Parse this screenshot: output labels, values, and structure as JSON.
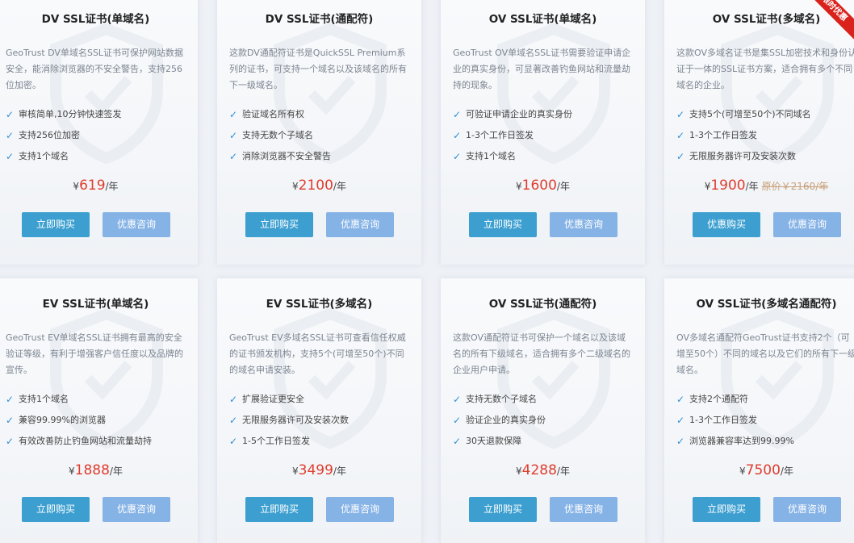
{
  "cards": [
    {
      "title": "DV SSL证书(单域名)",
      "desc": "GeoTrust DV单域名SSL证书可保护网站数据安全，能消除浏览器的不安全警告，支持256位加密。",
      "features": [
        "审核简单,10分钟快速签发",
        "支持256位加密",
        "支持1个域名"
      ],
      "currency": "¥",
      "price": "619",
      "unit": "/年",
      "buy_label": "立即购买",
      "consult_label": "优惠咨询"
    },
    {
      "title": "DV SSL证书(通配符)",
      "desc": "这款DV通配符证书是QuickSSL Premium系列的证书，可支持一个域名以及该域名的所有下一级域名。",
      "features": [
        "验证域名所有权",
        "支持无数个子域名",
        "消除浏览器不安全警告"
      ],
      "currency": "¥",
      "price": "2100",
      "unit": "/年",
      "buy_label": "立即购买",
      "consult_label": "优惠咨询"
    },
    {
      "title": "OV SSL证书(单域名)",
      "desc": "GeoTrust OV单域名SSL证书需要验证申请企业的真实身份，可显著改善钓鱼网站和流量劫持的现象。",
      "features": [
        "可验证申请企业的真实身份",
        "1-3个工作日签发",
        "支持1个域名"
      ],
      "currency": "¥",
      "price": "1600",
      "unit": "/年",
      "buy_label": "立即购买",
      "consult_label": "优惠咨询"
    },
    {
      "title": "OV SSL证书(多域名)",
      "desc": "这款OV多域名证书是集SSL加密技术和身份认证于一体的SSL证书方案，适合拥有多个不同域名的企业。",
      "features": [
        "支持5个(可增至50个)不同域名",
        "1-3个工作日签发",
        "无限服务器许可及安装次数"
      ],
      "currency": "¥",
      "price": "1900",
      "unit": "/年",
      "original_price": "原价￥2160/年",
      "ribbon": "限时优惠",
      "buy_label": "优惠购买",
      "consult_label": "优惠咨询"
    },
    {
      "title": "EV SSL证书(单域名)",
      "desc": "GeoTrust EV单域名SSL证书拥有最高的安全验证等级，有利于增强客户信任度以及品牌的宣传。",
      "features": [
        "支持1个域名",
        "兼容99.99%的浏览器",
        "有效改善防止钓鱼网站和流量劫持"
      ],
      "currency": "¥",
      "price": "1888",
      "unit": "/年",
      "buy_label": "立即购买",
      "consult_label": "优惠咨询"
    },
    {
      "title": "EV SSL证书(多域名)",
      "desc": "GeoTrust EV多域名SSL证书可查看信任权威的证书颁发机构，支持5个(可增至50个)不同的域名申请安装。",
      "features": [
        "扩展验证更安全",
        "无限服务器许可及安装次数",
        "1-5个工作日签发"
      ],
      "currency": "¥",
      "price": "3499",
      "unit": "/年",
      "buy_label": "立即购买",
      "consult_label": "优惠咨询"
    },
    {
      "title": "OV SSL证书(通配符)",
      "desc": "这款OV通配符证书可保护一个域名以及该域名的所有下级域名，适合拥有多个二级域名的企业用户申请。",
      "features": [
        "支持无数个子域名",
        "验证企业的真实身份",
        "30天退款保障"
      ],
      "currency": "¥",
      "price": "4288",
      "unit": "/年",
      "buy_label": "立即购买",
      "consult_label": "优惠咨询"
    },
    {
      "title": "OV SSL证书(多域名通配符)",
      "desc": "OV多域名通配符GeoTrust证书支持2个（可增至50个）不同的域名以及它们的所有下一级域名。",
      "features": [
        "支持2个通配符",
        "1-3个工作日签发",
        "浏览器兼容率达到99.99%"
      ],
      "currency": "¥",
      "price": "7500",
      "unit": "/年",
      "buy_label": "立即购买",
      "consult_label": "优惠咨询"
    }
  ],
  "colors": {
    "accent_price": "#e03c2e",
    "buy_button": "#3c9fd0",
    "consult_button": "#86b3e6",
    "check": "#2f8fd6",
    "ribbon": "#d9221c"
  }
}
